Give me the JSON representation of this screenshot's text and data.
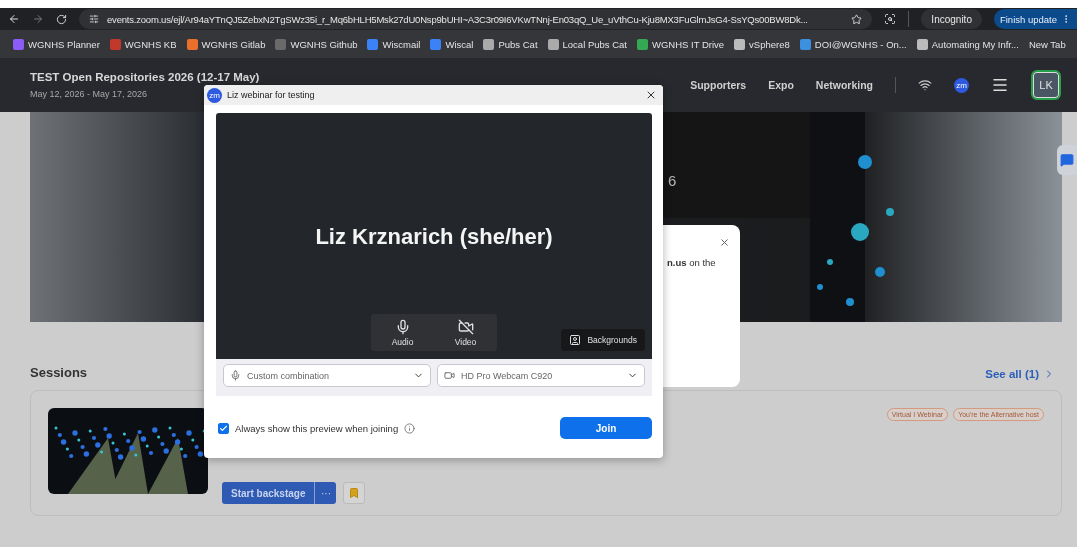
{
  "browser": {
    "url": "events.zoom.us/ejl/Ar94aYTnQJ5ZebxN2TgSWz35i_r_Mq6bHLH5Msk27dU0Nsp9bUHI~A3C3r09I6VKwTNnj-En03qQ_Ue_uVthCu-Kju8MX3FuGlmJsG4-SsYQs00BW8Dk...",
    "profile": "Incognito",
    "update_button": "Finish update",
    "bookmarks": [
      {
        "label": "WGNHS Planner"
      },
      {
        "label": "WGNHS KB"
      },
      {
        "label": "WGNHS Gitlab"
      },
      {
        "label": "WGNHS Github"
      },
      {
        "label": "Wiscmail"
      },
      {
        "label": "Wiscal"
      },
      {
        "label": "Pubs Cat"
      },
      {
        "label": "Local Pubs Cat"
      },
      {
        "label": "WGNHS IT Drive"
      },
      {
        "label": "vSphere8"
      },
      {
        "label": "DOI@WGNHS - On..."
      },
      {
        "label": "Automating My Infr..."
      },
      {
        "label": "New Tab"
      }
    ]
  },
  "event": {
    "title": "TEST Open Repositories 2026 (12-17 May)",
    "dates": "May 12, 2026 - May 17, 2026",
    "nav": [
      {
        "label": "Supporters"
      },
      {
        "label": "Expo"
      },
      {
        "label": "Networking"
      }
    ],
    "zoom_badge": "zm",
    "avatar": "LK",
    "hero_fragment": "6"
  },
  "popup": {
    "text": "**n.us** on the"
  },
  "sessions": {
    "title": "Sessions",
    "see_all": "See all (1)",
    "items": [
      {
        "tags": [
          "Virtual I Webinar",
          "You're the Alternative host"
        ],
        "primary_action": "Start backstage",
        "more": "···"
      }
    ]
  },
  "dialog": {
    "title": "Liz webinar for testing",
    "app_badge": "zm",
    "participant": "Liz Krznarich (she/her)",
    "controls": [
      {
        "label": "Audio",
        "kind": "mic",
        "off": false
      },
      {
        "label": "Video",
        "kind": "camera",
        "off": true
      }
    ],
    "backgrounds": "Backgrounds",
    "audio_device": "Custom combination",
    "video_device": "HD Pro Webcam C920",
    "always_show": {
      "label": "Always show this preview when joining",
      "checked": true
    },
    "join": "Join"
  }
}
